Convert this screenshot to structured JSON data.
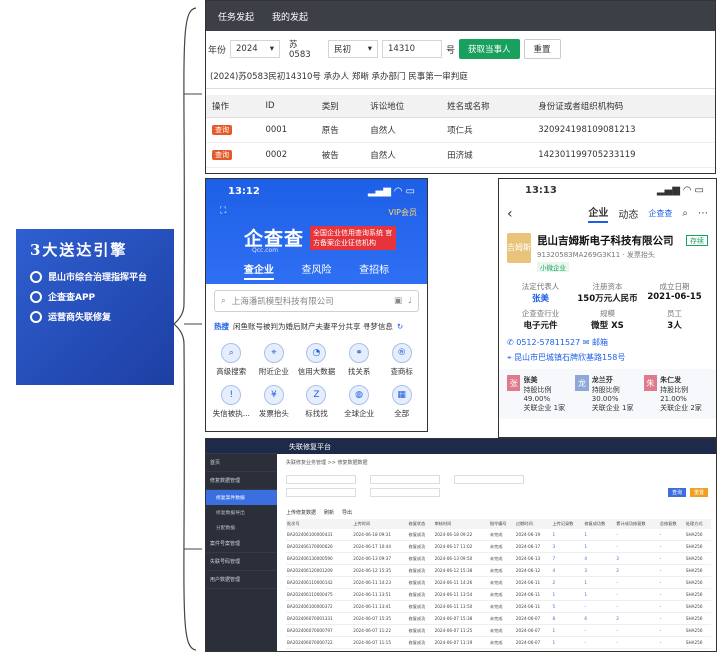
{
  "promo": {
    "title": "3大送达引擎",
    "items": [
      "昆山市综合治理指挥平台",
      "企查查APP",
      "运营商失联修复"
    ]
  },
  "panel1": {
    "tabs": [
      "任务发起",
      "我的发起"
    ],
    "year_label": "年份",
    "year_value": "2024",
    "court_code": "苏0583",
    "case_type": "民初",
    "case_no": "14310",
    "hao": "号",
    "fetch_button": "获取当事人",
    "reset_button": "重置",
    "case_info": "(2024)苏0583民初14310号 承办人 郑晰 承办部门 民事第一审判庭",
    "columns": [
      "操作",
      "ID",
      "类别",
      "诉讼地位",
      "姓名或名称",
      "身份证或者组织机构码"
    ],
    "rows": [
      {
        "op": "查询",
        "id": "0001",
        "type": "原告",
        "status": "自然人",
        "name": "项仁兵",
        "code": "320924198109081213"
      },
      {
        "op": "查询",
        "id": "0002",
        "type": "被告",
        "status": "自然人",
        "name": "田济城",
        "code": "142301199705233119"
      }
    ]
  },
  "panel2": {
    "time": "13:12",
    "vip": "VIP会员",
    "brand": "企查查",
    "brand_sub": "Qcc.com",
    "slogan": "全国企业信用查询系统 官方备案企业征信机构",
    "tabs": [
      "查企业",
      "查风险",
      "查招标"
    ],
    "search_placeholder": "上海潘凯模型科技有限公司",
    "news_tag": "热搜",
    "news": "闲鱼账号被判为婚后财产夫妻平分共享 寻梦信息",
    "grid": [
      "高级搜索",
      "附近企业",
      "信用大数据",
      "找关系",
      "查商标",
      "失信被执...",
      "发票抬头",
      "标找找",
      "全球企业",
      "全部"
    ],
    "grid_icons": [
      "search-icon",
      "location-icon",
      "data-icon",
      "relation-icon",
      "trademark-icon",
      "warning-icon",
      "invoice-icon",
      "bid-icon",
      "globe-icon",
      "grid-icon"
    ]
  },
  "panel3": {
    "time": "13:13",
    "nav": [
      "企业",
      "动态"
    ],
    "nav_brand": "企查查",
    "logo_text": "吉姆斯",
    "company": "昆山吉姆斯电子科技有限公司",
    "status": "存续",
    "credit_code": "91320583MA269G3K11",
    "invoice": "发票抬头",
    "tag": "小微企业",
    "facts_labels": [
      "法定代表人",
      "注册资本",
      "成立日期",
      "企查查行业",
      "规模",
      "员工"
    ],
    "facts_values": [
      "张美",
      "150万元人民币",
      "2021-06-15",
      "电子元件",
      "微型 XS",
      "3人"
    ],
    "phone": "0512-57811527",
    "mail": "邮箱",
    "address": "昆山市巴城镇石牌欣基路158号",
    "holders": [
      {
        "avatar": "张",
        "name": "张美",
        "ratio": "持股比例 49.00%",
        "link": "关联企业 1家"
      },
      {
        "avatar": "龙",
        "name": "龙兰芬",
        "ratio": "持股比例 30.00%",
        "link": "关联企业 1家"
      },
      {
        "avatar": "朱",
        "name": "朱仁发",
        "ratio": "持股比例 21.00%",
        "link": "关联企业 2家"
      }
    ]
  },
  "panel4": {
    "title": "失联修复平台",
    "side": [
      "首页",
      "修复数据管理",
      "修复案件数据",
      "修复数据导出",
      "分配数据",
      "案件号案管理",
      "失联号码管理",
      "用户数据管理"
    ],
    "breadcrumb": "失联修复业务管理 >> 修复数据数据",
    "search_button": "查询",
    "reset_button": "重置",
    "tools": [
      "上传修复数据",
      "刷新",
      "导出"
    ],
    "columns": [
      "批次号",
      "上传时间",
      "修复状态",
      "审核时间",
      "指令编号",
      "过期时间",
      "上传记录数",
      "修复成功数",
      "累计成功修复数",
      "总修复数",
      "处理方式"
    ],
    "rows": [
      [
        "BA202406100000431",
        "2024-06-18 09:31",
        "修复成功",
        "2024-06-18 09:22",
        "未完成",
        "2024-06-19",
        "1",
        "1",
        "-",
        "-",
        "SHA256"
      ],
      [
        "BA202406170000626",
        "2024-06-17 10:44",
        "修复成功",
        "2024-06-17 11:02",
        "未完成",
        "2024-06-17",
        "3",
        "1",
        "-",
        "-",
        "SHA256"
      ],
      [
        "BA202406130000590",
        "2024-06-13 09:37",
        "修复成功",
        "2024-06-13 09:50",
        "未完成",
        "2024-06-13",
        "7",
        "4",
        "3",
        "-",
        "SHA256"
      ],
      [
        "BA202406120001209",
        "2024-06-12 15:35",
        "修复成功",
        "2024-06-12 15:38",
        "未完成",
        "2024-06-12",
        "4",
        "3",
        "2",
        "-",
        "SHA256"
      ],
      [
        "BA202406110000142",
        "2024-06-11 14:23",
        "修复成功",
        "2024-06-11 14:26",
        "未完成",
        "2024-06-11",
        "2",
        "1",
        "-",
        "-",
        "SHA256"
      ],
      [
        "BA202406110000475",
        "2024-06-11 13:51",
        "修复成功",
        "2024-06-11 13:54",
        "未完成",
        "2024-06-11",
        "1",
        "1",
        "-",
        "-",
        "SHA256"
      ],
      [
        "BA202406100000372",
        "2024-06-11 13:41",
        "修复成功",
        "2024-06-11 13:50",
        "未完成",
        "2024-06-11",
        "5",
        "-",
        "-",
        "-",
        "SHA256"
      ],
      [
        "BA202406070001331",
        "2024-06-07 15:35",
        "修复成功",
        "2024-06-07 15:38",
        "未完成",
        "2024-06-07",
        "8",
        "6",
        "2",
        "-",
        "SHA256"
      ],
      [
        "BA202406070000797",
        "2024-06-07 11:22",
        "修复成功",
        "2024-06-07 11:25",
        "未完成",
        "2024-06-07",
        "1",
        "-",
        "-",
        "-",
        "SHA256"
      ],
      [
        "BA202406070000722",
        "2024-06-07 11:15",
        "修复成功",
        "2024-06-07 11:19",
        "未完成",
        "2024-06-07",
        "1",
        "-",
        "-",
        "-",
        "SHA256"
      ],
      [
        "BA202406070000497",
        "2024-06-07 10:23",
        "修复成功",
        "2024-06-07 10:26",
        "未完成",
        "2024-06-07",
        "1",
        "-",
        "-",
        "-",
        "SHA256"
      ],
      [
        "BA202406070000496",
        "2024-06-07 10:21",
        "修复成功",
        "2024-06-07 10:25",
        "未完成",
        "2024-06-07",
        "1",
        "-",
        "-",
        "-",
        "SHA256"
      ]
    ]
  }
}
